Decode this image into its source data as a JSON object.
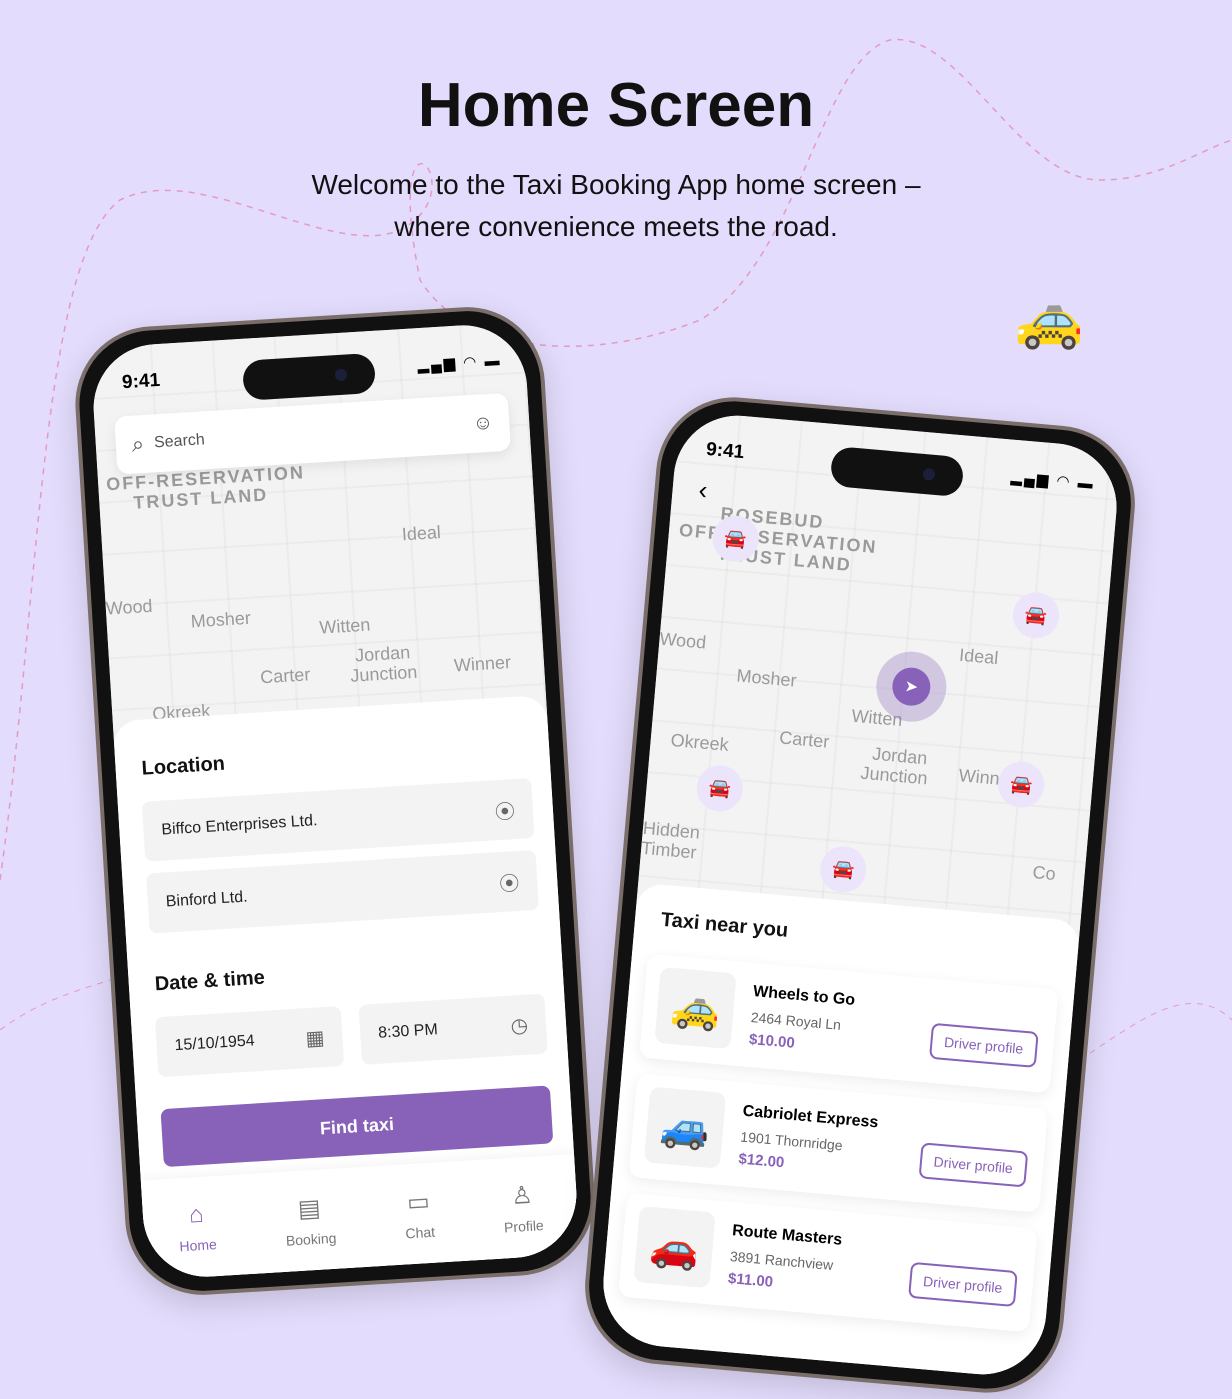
{
  "header": {
    "title": "Home Screen",
    "subtitle_line1": "Welcome to the Taxi Booking App home screen –",
    "subtitle_line2": "where convenience meets the road."
  },
  "colors": {
    "background": "#E3DCFC",
    "accent": "#8762B8"
  },
  "phone1": {
    "time": "9:41",
    "search_placeholder": "Search",
    "map_labels": [
      "OFF-RESERVATION",
      "TRUST LAND",
      "Ideal",
      "Wood",
      "Mosher",
      "Witten",
      "Jordan",
      "Junction",
      "Carter",
      "Winner",
      "Okreek"
    ],
    "location_label": "Location",
    "pickup": "Biffco Enterprises Ltd.",
    "dropoff": "Binford Ltd.",
    "datetime_label": "Date & time",
    "date": "15/10/1954",
    "time_value": "8:30 PM",
    "find_button": "Find taxi",
    "nav": [
      {
        "label": "Home",
        "icon": "home-icon"
      },
      {
        "label": "Booking",
        "icon": "booking-icon"
      },
      {
        "label": "Chat",
        "icon": "chat-icon"
      },
      {
        "label": "Profile",
        "icon": "profile-icon"
      }
    ]
  },
  "phone2": {
    "time": "9:41",
    "map_labels": [
      "ROSEBUD",
      "OFF-RESERVATION",
      "TRUST LAND",
      "Wood",
      "Ideal",
      "Mosher",
      "Witten",
      "Okreek",
      "Carter",
      "Jordan",
      "Junction",
      "Winner",
      "Hidden",
      "Timber",
      "Co"
    ],
    "section_title": "Taxi near you",
    "taxis": [
      {
        "name": "Wheels to Go",
        "address": "2464 Royal Ln",
        "price": "$10.00",
        "button": "Driver profile",
        "car": "🚕"
      },
      {
        "name": "Cabriolet Express",
        "address": "1901 Thornridge",
        "price": "$12.00",
        "button": "Driver profile",
        "car": "🚙"
      },
      {
        "name": "Route Masters",
        "address": "3891 Ranchview",
        "price": "$11.00",
        "button": "Driver profile",
        "car": "🚗"
      }
    ]
  }
}
